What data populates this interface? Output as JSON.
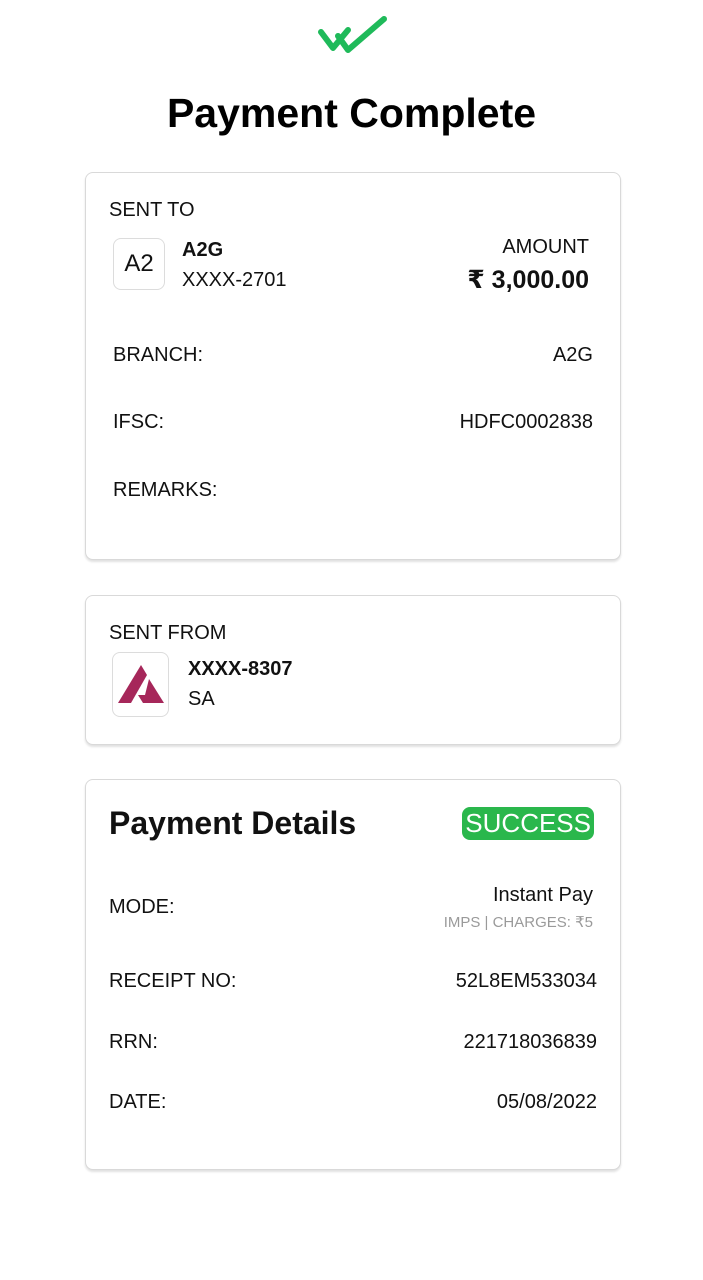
{
  "header": {
    "icon": "double-check-icon",
    "accent_color": "#1fba5a",
    "title": "Payment Complete"
  },
  "sent_to": {
    "section_label": "SENT TO",
    "avatar_text": "A2",
    "name": "A2G",
    "account": "XXXX-2701",
    "amount_label": "AMOUNT",
    "amount": "₹ 3,000.00",
    "branch_label": "BRANCH:",
    "branch_value": "A2G",
    "ifsc_label": "IFSC:",
    "ifsc_value": "HDFC0002838",
    "remarks_label": "REMARKS:",
    "remarks_value": ""
  },
  "sent_from": {
    "section_label": "SENT FROM",
    "bank_logo": "axis-bank-logo",
    "bank_logo_color": "#a6275a",
    "account": "XXXX-8307",
    "account_type": "SA"
  },
  "payment_details": {
    "title": "Payment Details",
    "status": "SUCCESS",
    "status_color": "#2ab74c",
    "mode_label": "MODE:",
    "mode_value": "Instant Pay",
    "mode_sub": "IMPS | CHARGES: ₹5",
    "receipt_label": "RECEIPT NO:",
    "receipt_value": "52L8EM533034",
    "rrn_label": "RRN:",
    "rrn_value": "221718036839",
    "date_label": "DATE:",
    "date_value": "05/08/2022"
  }
}
